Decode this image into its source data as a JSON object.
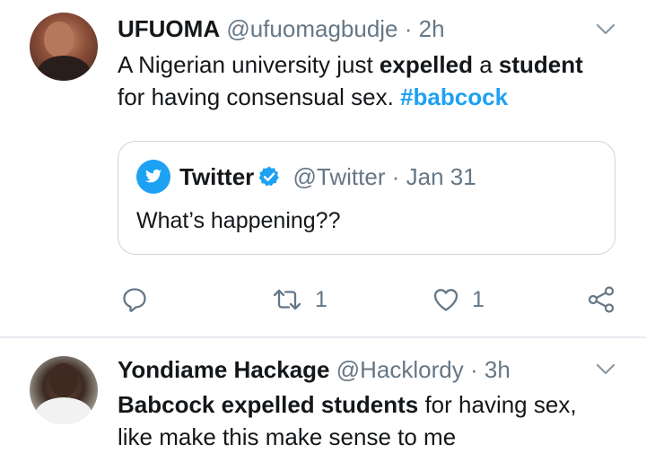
{
  "tweets": [
    {
      "author": "UFUOMA",
      "handle": "@ufuomagbudje",
      "time": "2h",
      "text_segments": [
        {
          "t": "A Nigerian university just ",
          "s": "normal"
        },
        {
          "t": "expelled",
          "s": "bold"
        },
        {
          "t": " a ",
          "s": "normal"
        },
        {
          "t": "student",
          "s": "bold"
        },
        {
          "t": "for having consensual sex. ",
          "s": "normal"
        },
        {
          "t": "#babcock",
          "s": "hashtag"
        }
      ],
      "quote": {
        "author": "Twitter",
        "handle": "@Twitter",
        "time": "Jan 31",
        "text": "What’s happening??"
      },
      "retweets": "1",
      "likes": "1"
    },
    {
      "author": "Yondiame Hackage",
      "handle": "@Hacklordy",
      "time": "3h",
      "text_segments": [
        {
          "t": "Babcock expelled students",
          "s": "bold"
        },
        {
          "t": " for having sex,",
          "s": "normal"
        },
        {
          "t": "like make this make sense to me",
          "s": "normal"
        }
      ]
    }
  ],
  "sep": "·",
  "colors": {
    "accent": "#1da1f2",
    "muted": "#657786",
    "text": "#14171a",
    "border": "#ccd6dd"
  },
  "icons": [
    "chevron-down-icon",
    "twitter-bird-icon",
    "verified-badge-icon",
    "reply-icon",
    "retweet-icon",
    "heart-icon",
    "share-icon"
  ]
}
